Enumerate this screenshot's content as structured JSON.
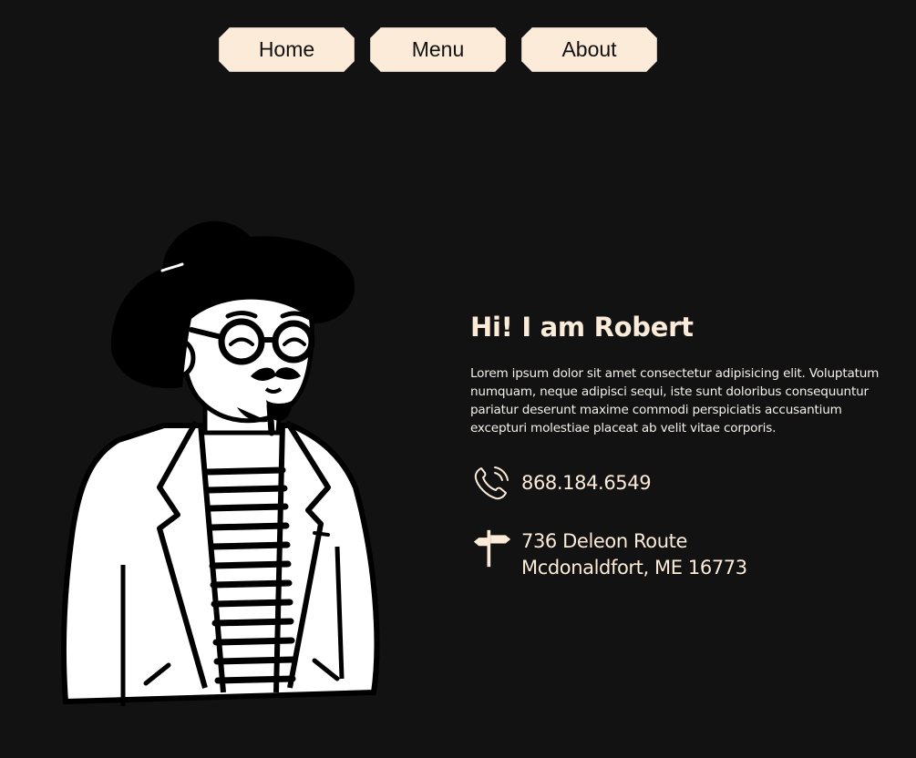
{
  "nav": {
    "items": [
      {
        "label": "Home"
      },
      {
        "label": "Menu"
      },
      {
        "label": "About"
      }
    ]
  },
  "profile": {
    "greeting": "Hi! I am Robert",
    "bio": "Lorem ipsum dolor sit amet consectetur adipisicing elit. Voluptatum numquam, neque adipisci sequi, iste sunt doloribus consequuntur pariatur deserunt maxime commodi perspiciatis accusantium excepturi molestiae placeat ab velit vitae corporis.",
    "phone": "868.184.6549",
    "address_line1": "736 Deleon Route",
    "address_line2": "Mcdonaldfort, ME 16773"
  },
  "icons": {
    "phone": "phone-icon",
    "address": "signpost-icon",
    "illustration": "man-with-hat-illustration"
  },
  "colors": {
    "background": "#121212",
    "accent": "#fbebd8",
    "text": "#f4f0ea"
  }
}
